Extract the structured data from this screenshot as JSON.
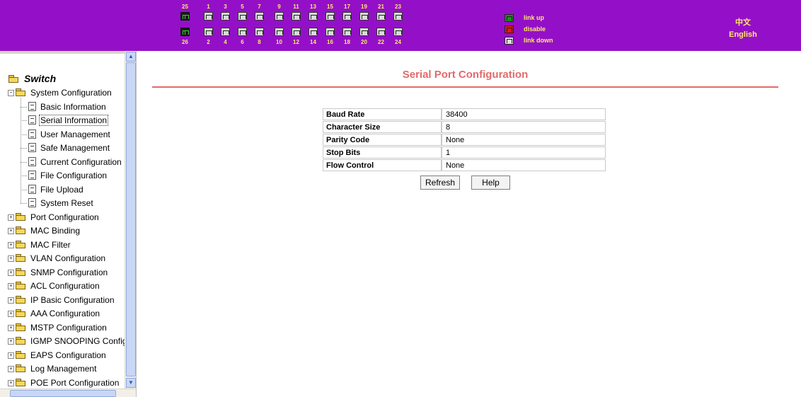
{
  "header": {
    "ports": {
      "top_numbers": [
        "25",
        "1",
        "3",
        "5",
        "7",
        "9",
        "11",
        "13",
        "15",
        "17",
        "19",
        "21",
        "23"
      ],
      "bottom_numbers": [
        "26",
        "2",
        "4",
        "6",
        "8",
        "10",
        "12",
        "14",
        "16",
        "18",
        "20",
        "22",
        "24"
      ]
    },
    "legend": [
      {
        "label": "link up",
        "icon": "port-link-up-icon",
        "color": "#1d8f1d"
      },
      {
        "label": "disable",
        "icon": "port-disable-icon",
        "color": "#e01818"
      },
      {
        "label": "link down",
        "icon": "port-link-down-icon",
        "color": "#dedede"
      }
    ],
    "languages": [
      "中文",
      "English"
    ],
    "colors": {
      "background": "#9410c8",
      "text": "#ffe96a"
    }
  },
  "sidebar": {
    "root": "Switch",
    "expanded": {
      "label": "System Configuration",
      "children": [
        "Basic Information",
        "Serial Information",
        "User Management",
        "Safe Management",
        "Current Configuration",
        "File Configuration",
        "File Upload",
        "System Reset"
      ],
      "selected": "Serial Information"
    },
    "collapsed": [
      "Port Configuration",
      "MAC Binding",
      "MAC Filter",
      "VLAN Configuration",
      "SNMP Configuration",
      "ACL Configuration",
      "IP Basic Configuration",
      "AAA Configuration",
      "MSTP Configuration",
      "IGMP SNOOPING Config",
      "EAPS Configuration",
      "Log Management",
      "POE Port Configuration"
    ]
  },
  "main": {
    "title": "Serial Port Configuration",
    "title_color": "#e26a6a",
    "rows": [
      {
        "label": "Baud Rate",
        "value": "38400"
      },
      {
        "label": "Character Size",
        "value": "8"
      },
      {
        "label": "Parity Code",
        "value": "None"
      },
      {
        "label": "Stop Bits",
        "value": "1"
      },
      {
        "label": "Flow Control",
        "value": "None"
      }
    ],
    "buttons": {
      "refresh": "Refresh",
      "help": "Help"
    }
  }
}
